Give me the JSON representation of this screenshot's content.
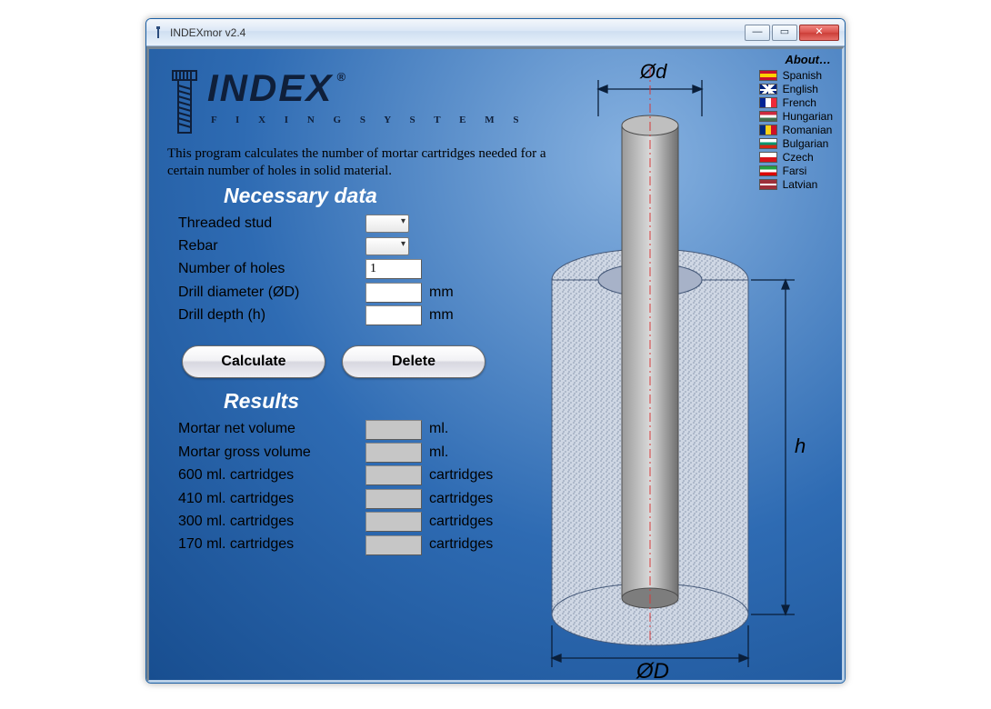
{
  "window": {
    "title": "INDEXmor v2.4"
  },
  "logo": {
    "brand": "INDEX",
    "tagline": "F I X I N G   S Y S T E M S"
  },
  "intro": "This program calculates the number of mortar cartridges needed for a certain number of holes in solid material.",
  "section_data": "Necessary data",
  "inputs": {
    "stud_label": "Threaded stud",
    "rebar_label": "Rebar",
    "holes_label": "Number of holes",
    "holes_value": "1",
    "diam_label": "Drill diameter (ØD)",
    "diam_value": "",
    "depth_label": "Drill depth (h)",
    "depth_value": "",
    "unit_mm": "mm"
  },
  "buttons": {
    "calc": "Calculate",
    "del": "Delete"
  },
  "section_results": "Results",
  "results": {
    "r0": {
      "label": "Mortar net volume",
      "unit": "ml."
    },
    "r1": {
      "label": "Mortar gross volume",
      "unit": "ml."
    },
    "r2": {
      "label": "600 ml. cartridges",
      "unit": "cartridges"
    },
    "r3": {
      "label": "410 ml. cartridges",
      "unit": "cartridges"
    },
    "r4": {
      "label": "300 ml. cartridges",
      "unit": "cartridges"
    },
    "r5": {
      "label": "170 ml. cartridges",
      "unit": "cartridges"
    }
  },
  "diagram": {
    "d_small": "Ød",
    "d_big": "ØD",
    "h": "h"
  },
  "about": "About…",
  "langs": {
    "l0": "Spanish",
    "l1": "English",
    "l2": "French",
    "l3": "Hungarian",
    "l4": "Romanian",
    "l5": "Bulgarian",
    "l6": "Czech",
    "l7": "Farsi",
    "l8": "Latvian"
  }
}
